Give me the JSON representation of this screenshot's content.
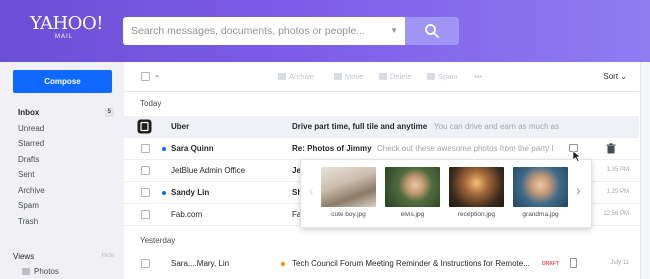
{
  "app": {
    "logo_line1": "YAHOO!",
    "logo_line2": "MAIL",
    "brand_color": "#7c5ce8"
  },
  "search": {
    "placeholder": "Search messages, documents, photos or people..."
  },
  "sidebar": {
    "compose_label": "Compose",
    "folders": [
      {
        "label": "Inbox",
        "count": "5"
      },
      {
        "label": "Unread"
      },
      {
        "label": "Starred"
      },
      {
        "label": "Drafts"
      },
      {
        "label": "Sent"
      },
      {
        "label": "Archive"
      },
      {
        "label": "Spam"
      },
      {
        "label": "Trash"
      }
    ],
    "views_label": "Views",
    "views_hide": "Hide",
    "photos_label": "Photos"
  },
  "toolbar": {
    "archive": "Archive",
    "move": "Move",
    "delete": "Delete",
    "spam": "Spam",
    "more": "•••",
    "sort": "Sort"
  },
  "sections": {
    "today": "Today",
    "yesterday": "Yesterday"
  },
  "messages": [
    {
      "sender": "Uber",
      "subject": "Drive part time, full tile and anytime",
      "preview": "You can drive and earn as much as",
      "time": ""
    },
    {
      "sender": "Sara Quinn",
      "subject": "Re: Photos of Jimmy",
      "preview": "Check out these awesome photos from the party I",
      "time": ""
    },
    {
      "sender": "JetBlue Admin Office",
      "subject": "Je",
      "preview": "",
      "time": "1:35 PM"
    },
    {
      "sender": "Sandy Lin",
      "subject": "Sh",
      "preview": "",
      "time": "1:25 PM"
    },
    {
      "sender": "Fab.com",
      "subject": "Fa",
      "preview": "",
      "time": "12:56 PM"
    },
    {
      "sender": "Sara....Mary, Lin",
      "subject": "Tech Council Forum Meeting Reminder & Instructions for Remote...",
      "preview": "",
      "time": "July 11",
      "draft": "DRAFT"
    }
  ],
  "attachments": [
    {
      "name": "cute boy.jpg"
    },
    {
      "name": "elvis.jpg"
    },
    {
      "name": "reception.jpg"
    },
    {
      "name": "grandma.jpg"
    }
  ]
}
